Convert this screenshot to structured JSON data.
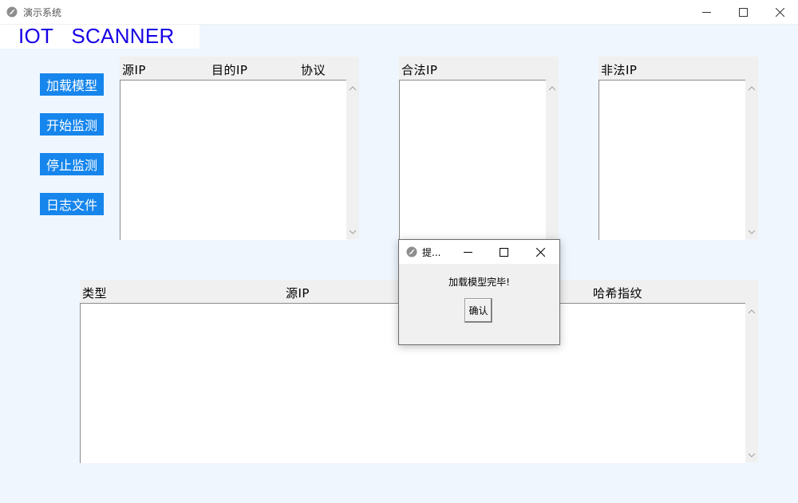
{
  "window": {
    "title": "演示系统",
    "controls": {
      "minimize": "minimize-icon",
      "maximize": "maximize-icon",
      "close": "close-icon"
    }
  },
  "banner": {
    "text": "IOT   SCANNER",
    "color": "#1700e6"
  },
  "sidebar": {
    "buttons": [
      {
        "label": "加载模型"
      },
      {
        "label": "开始监测"
      },
      {
        "label": "停止监测"
      },
      {
        "label": "日志文件"
      }
    ],
    "button_color": "#1685ec"
  },
  "traffic_panel": {
    "columns": [
      "源IP",
      "目的IP",
      "协议"
    ],
    "rows": []
  },
  "legal_panel": {
    "columns": [
      "合法IP"
    ],
    "rows": []
  },
  "illegal_panel": {
    "columns": [
      "非法IP"
    ],
    "rows": []
  },
  "log_panel": {
    "columns": [
      "类型",
      "源IP",
      "哈希指纹"
    ],
    "rows": []
  },
  "dialog": {
    "title": "提...",
    "message": "加载模型完毕!",
    "ok_label": "确认"
  }
}
